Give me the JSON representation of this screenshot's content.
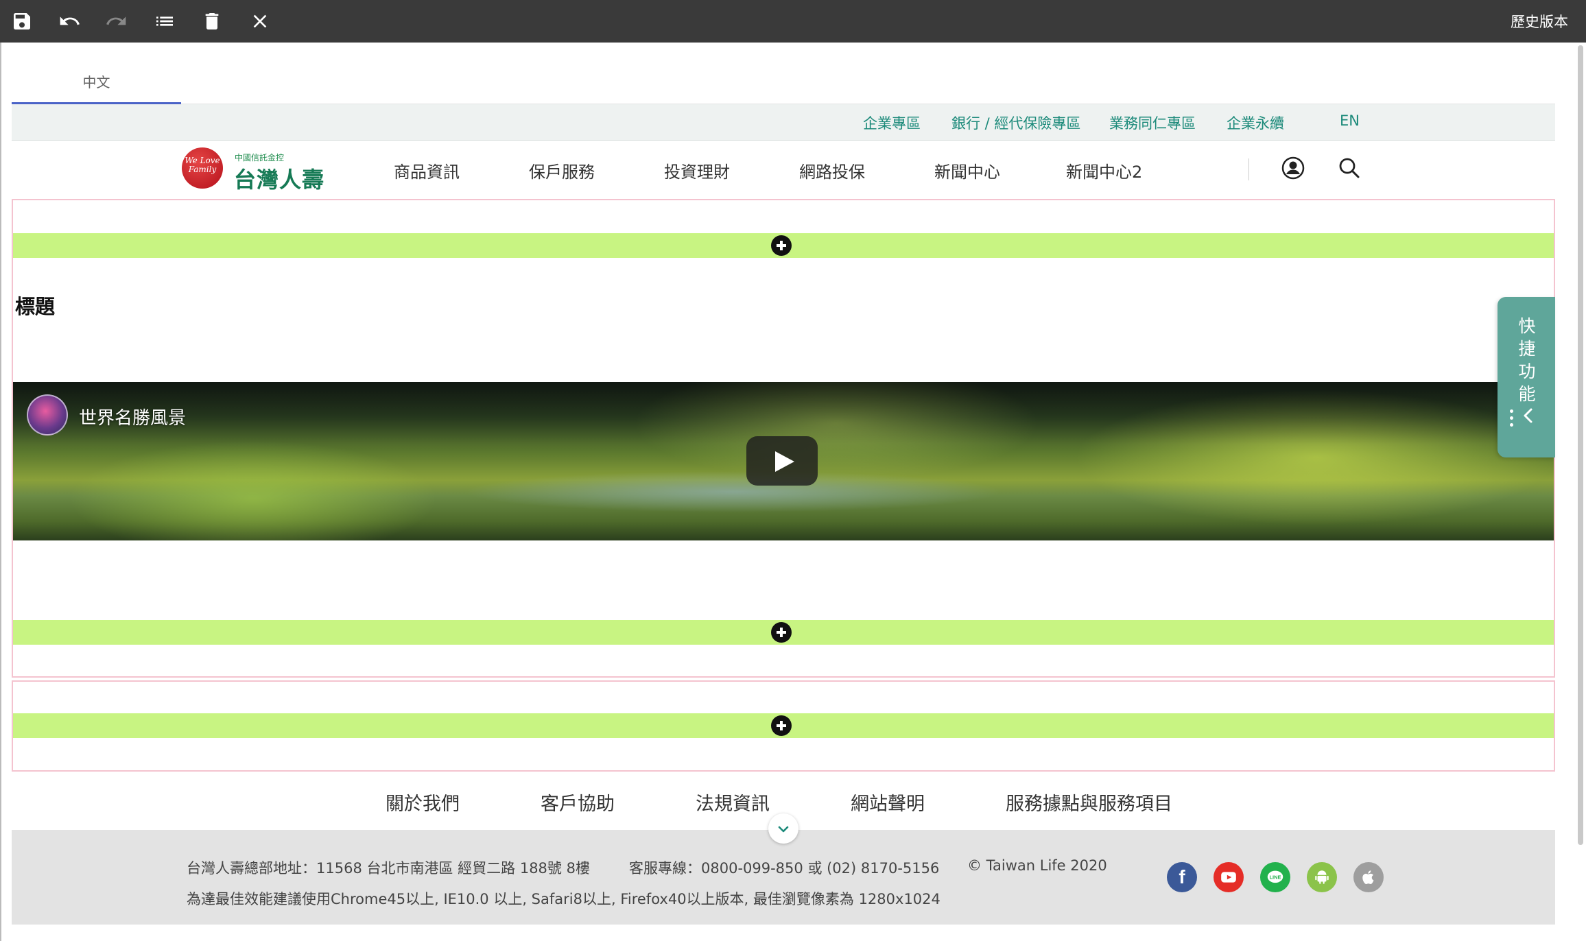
{
  "toolbar": {
    "history_label": "歷史版本",
    "icons": [
      "save-icon",
      "undo-icon",
      "redo-icon",
      "list-icon",
      "trash-icon",
      "close-icon"
    ]
  },
  "lang_tabs": [
    {
      "label": "中文",
      "active": true
    }
  ],
  "utility_links": [
    "企業專區",
    "銀行 / 經代保險專區",
    "業務同仁專區",
    "企業永續",
    "EN"
  ],
  "logo": {
    "small_text": "中國信託金控",
    "main_text": "台灣人壽",
    "emblem_text": "We Love Family"
  },
  "nav": {
    "items": [
      "商品資訊",
      "保戶服務",
      "投資理財",
      "網路投保",
      "新聞中心",
      "新聞中心2"
    ],
    "icons": [
      "user-icon",
      "search-icon"
    ]
  },
  "content": {
    "block_title": "標題",
    "video": {
      "channel_title": "世界名勝風景"
    }
  },
  "quick_tab": {
    "chars": [
      "快",
      "捷",
      "功",
      "能"
    ]
  },
  "footer": {
    "links": [
      "關於我們",
      "客戶協助",
      "法規資訊",
      "網站聲明",
      "服務據點與服務項目"
    ],
    "address": "台灣人壽總部地址：11568 台北市南港區 經貿二路 188號 8樓",
    "hotline": "客服專線：0800-099-850 或 (02) 8170-5156",
    "copyright": "© Taiwan Life 2020",
    "browser_note": "為達最佳效能建議使用Chrome45以上, IE10.0 以上, Safari8以上, Firefox40以上版本, 最佳瀏覽像素為 1280x1024",
    "social": [
      {
        "name": "facebook-icon",
        "color": "#3b5998",
        "glyph": "f"
      },
      {
        "name": "youtube-icon",
        "color": "#e52d27",
        "glyph": "▶"
      },
      {
        "name": "line-icon",
        "color": "#22b14c",
        "glyph": "LINE"
      },
      {
        "name": "android-icon",
        "color": "#8bc34a",
        "glyph": ""
      },
      {
        "name": "apple-icon",
        "color": "#9e9e9e",
        "glyph": ""
      }
    ]
  },
  "colors": {
    "toolbar_bg": "#3a3a3a",
    "accent_teal": "#1c8a7a",
    "add_bar": "#c8f482",
    "block_border": "#f4c3cf",
    "tab_underline": "#4a63c7",
    "quick_tab": "#5fa69a"
  }
}
